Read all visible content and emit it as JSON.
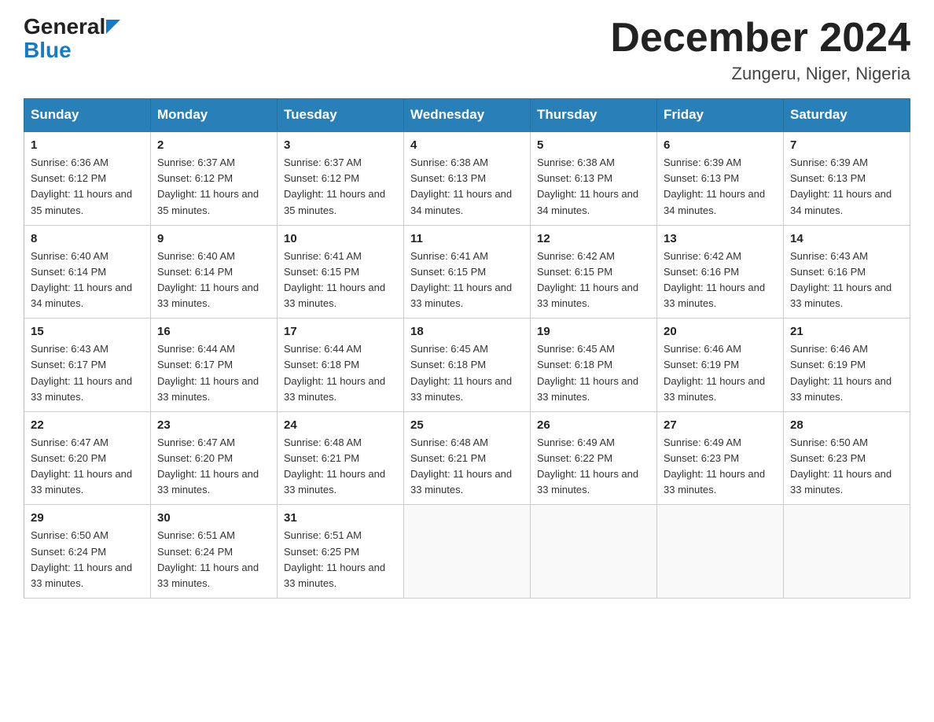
{
  "header": {
    "logo_general": "General",
    "logo_blue": "Blue",
    "month_title": "December 2024",
    "location": "Zungeru, Niger, Nigeria"
  },
  "calendar": {
    "days_of_week": [
      "Sunday",
      "Monday",
      "Tuesday",
      "Wednesday",
      "Thursday",
      "Friday",
      "Saturday"
    ],
    "weeks": [
      [
        {
          "date": "1",
          "sunrise": "6:36 AM",
          "sunset": "6:12 PM",
          "daylight": "11 hours and 35 minutes."
        },
        {
          "date": "2",
          "sunrise": "6:37 AM",
          "sunset": "6:12 PM",
          "daylight": "11 hours and 35 minutes."
        },
        {
          "date": "3",
          "sunrise": "6:37 AM",
          "sunset": "6:12 PM",
          "daylight": "11 hours and 35 minutes."
        },
        {
          "date": "4",
          "sunrise": "6:38 AM",
          "sunset": "6:13 PM",
          "daylight": "11 hours and 34 minutes."
        },
        {
          "date": "5",
          "sunrise": "6:38 AM",
          "sunset": "6:13 PM",
          "daylight": "11 hours and 34 minutes."
        },
        {
          "date": "6",
          "sunrise": "6:39 AM",
          "sunset": "6:13 PM",
          "daylight": "11 hours and 34 minutes."
        },
        {
          "date": "7",
          "sunrise": "6:39 AM",
          "sunset": "6:13 PM",
          "daylight": "11 hours and 34 minutes."
        }
      ],
      [
        {
          "date": "8",
          "sunrise": "6:40 AM",
          "sunset": "6:14 PM",
          "daylight": "11 hours and 34 minutes."
        },
        {
          "date": "9",
          "sunrise": "6:40 AM",
          "sunset": "6:14 PM",
          "daylight": "11 hours and 33 minutes."
        },
        {
          "date": "10",
          "sunrise": "6:41 AM",
          "sunset": "6:15 PM",
          "daylight": "11 hours and 33 minutes."
        },
        {
          "date": "11",
          "sunrise": "6:41 AM",
          "sunset": "6:15 PM",
          "daylight": "11 hours and 33 minutes."
        },
        {
          "date": "12",
          "sunrise": "6:42 AM",
          "sunset": "6:15 PM",
          "daylight": "11 hours and 33 minutes."
        },
        {
          "date": "13",
          "sunrise": "6:42 AM",
          "sunset": "6:16 PM",
          "daylight": "11 hours and 33 minutes."
        },
        {
          "date": "14",
          "sunrise": "6:43 AM",
          "sunset": "6:16 PM",
          "daylight": "11 hours and 33 minutes."
        }
      ],
      [
        {
          "date": "15",
          "sunrise": "6:43 AM",
          "sunset": "6:17 PM",
          "daylight": "11 hours and 33 minutes."
        },
        {
          "date": "16",
          "sunrise": "6:44 AM",
          "sunset": "6:17 PM",
          "daylight": "11 hours and 33 minutes."
        },
        {
          "date": "17",
          "sunrise": "6:44 AM",
          "sunset": "6:18 PM",
          "daylight": "11 hours and 33 minutes."
        },
        {
          "date": "18",
          "sunrise": "6:45 AM",
          "sunset": "6:18 PM",
          "daylight": "11 hours and 33 minutes."
        },
        {
          "date": "19",
          "sunrise": "6:45 AM",
          "sunset": "6:18 PM",
          "daylight": "11 hours and 33 minutes."
        },
        {
          "date": "20",
          "sunrise": "6:46 AM",
          "sunset": "6:19 PM",
          "daylight": "11 hours and 33 minutes."
        },
        {
          "date": "21",
          "sunrise": "6:46 AM",
          "sunset": "6:19 PM",
          "daylight": "11 hours and 33 minutes."
        }
      ],
      [
        {
          "date": "22",
          "sunrise": "6:47 AM",
          "sunset": "6:20 PM",
          "daylight": "11 hours and 33 minutes."
        },
        {
          "date": "23",
          "sunrise": "6:47 AM",
          "sunset": "6:20 PM",
          "daylight": "11 hours and 33 minutes."
        },
        {
          "date": "24",
          "sunrise": "6:48 AM",
          "sunset": "6:21 PM",
          "daylight": "11 hours and 33 minutes."
        },
        {
          "date": "25",
          "sunrise": "6:48 AM",
          "sunset": "6:21 PM",
          "daylight": "11 hours and 33 minutes."
        },
        {
          "date": "26",
          "sunrise": "6:49 AM",
          "sunset": "6:22 PM",
          "daylight": "11 hours and 33 minutes."
        },
        {
          "date": "27",
          "sunrise": "6:49 AM",
          "sunset": "6:23 PM",
          "daylight": "11 hours and 33 minutes."
        },
        {
          "date": "28",
          "sunrise": "6:50 AM",
          "sunset": "6:23 PM",
          "daylight": "11 hours and 33 minutes."
        }
      ],
      [
        {
          "date": "29",
          "sunrise": "6:50 AM",
          "sunset": "6:24 PM",
          "daylight": "11 hours and 33 minutes."
        },
        {
          "date": "30",
          "sunrise": "6:51 AM",
          "sunset": "6:24 PM",
          "daylight": "11 hours and 33 minutes."
        },
        {
          "date": "31",
          "sunrise": "6:51 AM",
          "sunset": "6:25 PM",
          "daylight": "11 hours and 33 minutes."
        },
        null,
        null,
        null,
        null
      ]
    ]
  }
}
